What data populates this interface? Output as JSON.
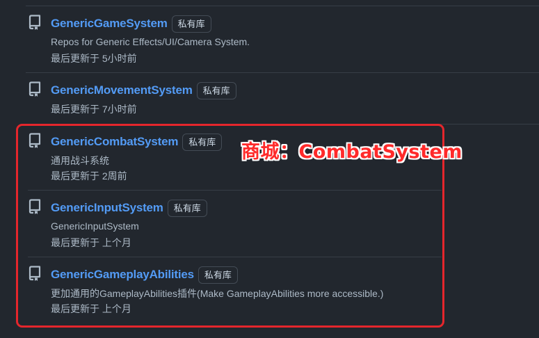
{
  "repos": [
    {
      "name": "GenericGameSystem",
      "badge": "私有库",
      "description": "Repos for Generic Effects/UI/Camera System.",
      "updated": "最后更新于 5小时前"
    },
    {
      "name": "GenericMovementSystem",
      "badge": "私有库",
      "description": "",
      "updated": "最后更新于 7小时前"
    },
    {
      "name": "GenericCombatSystem",
      "badge": "私有库",
      "description": "通用战斗系统",
      "updated": "最后更新于 2周前"
    },
    {
      "name": "GenericInputSystem",
      "badge": "私有库",
      "description": "GenericInputSystem",
      "updated": "最后更新于 上个月"
    },
    {
      "name": "GenericGameplayAbilities",
      "badge": "私有库",
      "description": "更加通用的GameplayAbilities插件(Make GameplayAbilities more accessible.)",
      "updated": "最后更新于 上个月"
    }
  ],
  "annotation": {
    "text": "商城：CombatSystem",
    "color": "#ff2a2a"
  },
  "icons": {
    "repo": "repo-icon"
  },
  "colors": {
    "background": "#22272e",
    "link": "#539bf5",
    "highlight_border": "#e5262c"
  }
}
